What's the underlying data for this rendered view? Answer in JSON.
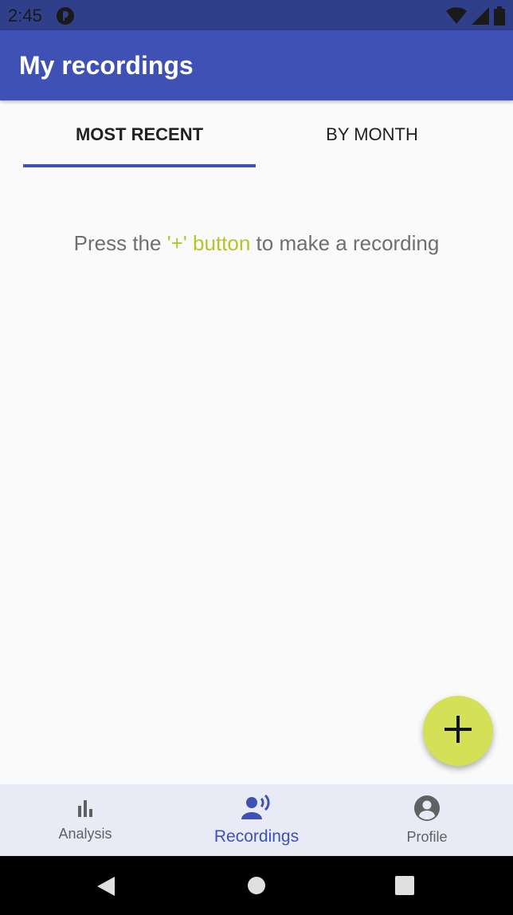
{
  "status_bar": {
    "time": "2:45",
    "icons": [
      "app-notification-icon",
      "wifi-icon",
      "signal-icon",
      "battery-icon"
    ]
  },
  "app_bar": {
    "title": "My recordings",
    "color": "#3f51b5"
  },
  "tabs": [
    {
      "label": "MOST RECENT",
      "selected": true
    },
    {
      "label": "BY MONTH",
      "selected": false
    }
  ],
  "empty_state": {
    "prefix": "Press the ",
    "accent": "'+' button",
    "suffix": " to make a recording",
    "accent_color": "#b5c42a"
  },
  "fab": {
    "icon": "plus-icon",
    "color": "#d4e157"
  },
  "bottom_nav": {
    "items": [
      {
        "label": "Analysis",
        "icon": "bar-chart-icon",
        "selected": false
      },
      {
        "label": "Recordings",
        "icon": "voice-recording-icon",
        "selected": true
      },
      {
        "label": "Profile",
        "icon": "account-circle-icon",
        "selected": false
      }
    ]
  },
  "system_nav": {
    "icons": [
      "back-icon",
      "home-icon",
      "recents-icon"
    ]
  }
}
